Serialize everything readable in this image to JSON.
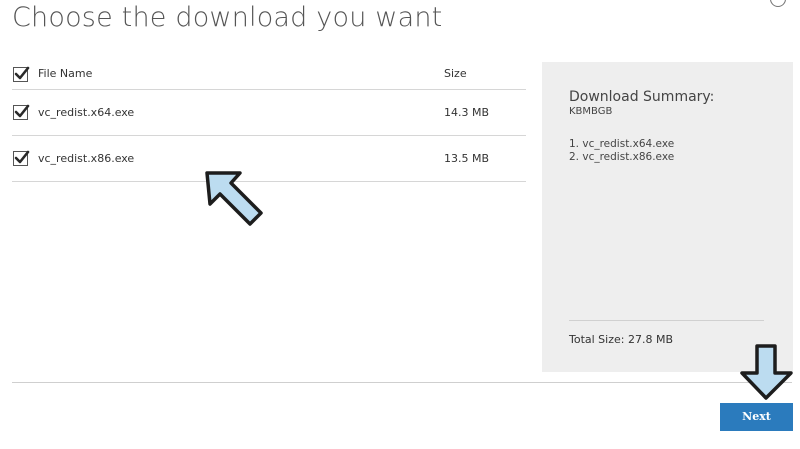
{
  "page": {
    "title": "Choose the download you want"
  },
  "table": {
    "header": {
      "name_label": "File Name",
      "size_label": "Size",
      "select_all_checked": true
    },
    "rows": [
      {
        "name": "vc_redist.x64.exe",
        "size": "14.3 MB",
        "checked": true
      },
      {
        "name": "vc_redist.x86.exe",
        "size": "13.5 MB",
        "checked": true
      }
    ]
  },
  "summary": {
    "title": "Download Summary:",
    "kb": "KBMBGB",
    "items": [
      "1. vc_redist.x64.exe",
      "2. vc_redist.x86.exe"
    ],
    "total": "Total Size: 27.8 MB"
  },
  "footer": {
    "next_label": "Next"
  },
  "colors": {
    "accent": "#2b7bbd",
    "panel": "#eeeeee",
    "arrow_fill": "#bcdcf0"
  }
}
